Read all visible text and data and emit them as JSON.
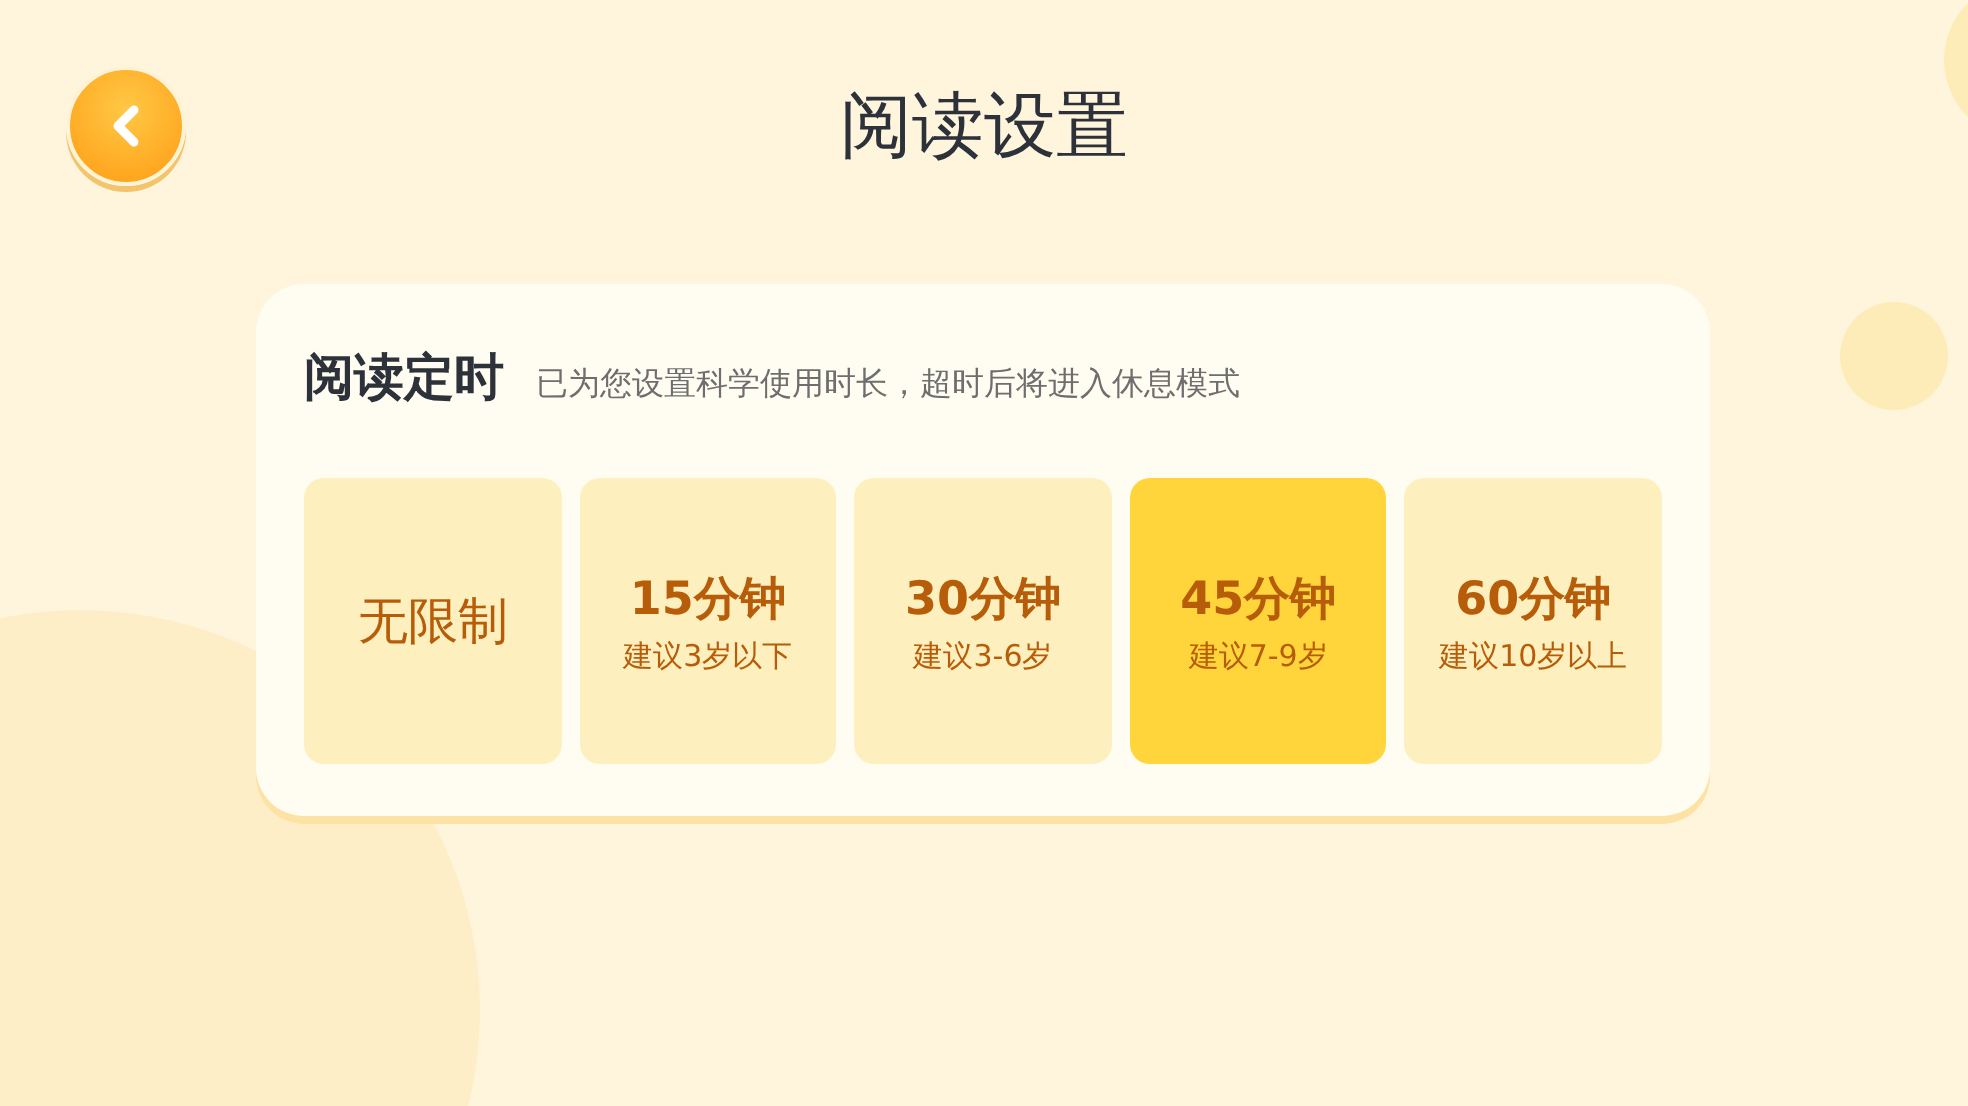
{
  "header": {
    "title": "阅读设置"
  },
  "timer": {
    "title": "阅读定时",
    "description": "已为您设置科学使用时长，超时后将进入休息模式",
    "options": [
      {
        "label": "无限制",
        "selected": false
      },
      {
        "label": "15分钟",
        "hint": "建议3岁以下",
        "selected": false
      },
      {
        "label": "30分钟",
        "hint": "建议3-6岁",
        "selected": false
      },
      {
        "label": "45分钟",
        "hint": "建议7-9岁",
        "selected": true
      },
      {
        "label": "60分钟",
        "hint": "建议10岁以上",
        "selected": false
      }
    ]
  }
}
